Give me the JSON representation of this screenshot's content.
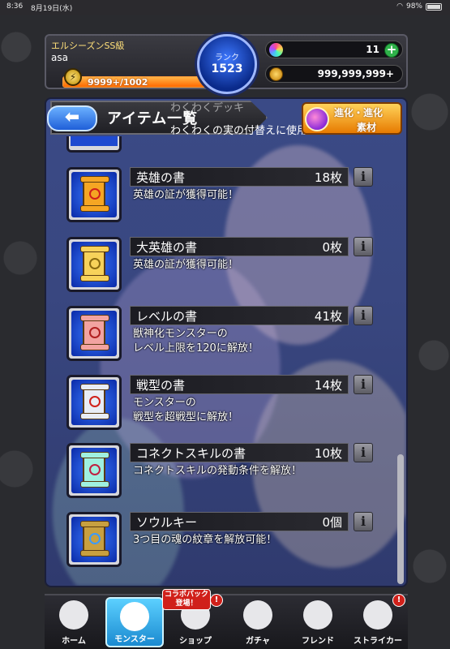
{
  "status_bar": {
    "time": "8:36",
    "date": "8月19日(水)",
    "battery": "98%"
  },
  "header": {
    "season": "エルシーズンSS級",
    "player_name": "asa",
    "stamina_text": "9999+/1002",
    "stamina_level": 1.0,
    "rank_label": "ランク",
    "rank_value": "1523",
    "gems": "11",
    "gold": "999,999,999+"
  },
  "title_bar": {
    "title": "アイテム一覧",
    "ghost_top": "わくわくデッキ",
    "ghost_bottom": "わくわくの実の付替えに使用！"
  },
  "evolve_button": {
    "line1": "進化・進化",
    "line2": "素材"
  },
  "items": [
    {
      "name": "英雄の書",
      "count": "18枚",
      "desc": [
        "英雄の証が獲得可能！"
      ],
      "scroll_color": "#f5a623",
      "mark_color": "#d0201a"
    },
    {
      "name": "大英雄の書",
      "count": "0枚",
      "desc": [
        "英雄の証が獲得可能！"
      ],
      "scroll_color": "#f7d25a",
      "mark_color": "#8a6a10"
    },
    {
      "name": "レベルの書",
      "count": "41枚",
      "desc": [
        "獣神化モンスターの",
        "レベル上限を120に解放！"
      ],
      "scroll_color": "#f2a3a0",
      "mark_color": "#b02020"
    },
    {
      "name": "戦型の書",
      "count": "14枚",
      "desc": [
        "モンスターの",
        "戦型を超戦型に解放！"
      ],
      "scroll_color": "#e8ecf5",
      "mark_color": "#d0201a"
    },
    {
      "name": "コネクトスキルの書",
      "count": "10枚",
      "desc": [
        "コネクトスキルの発動条件を解放！"
      ],
      "scroll_color": "#9ff0e0",
      "mark_color": "#c02040"
    },
    {
      "name": "ソウルキー",
      "count": "0個",
      "desc": [
        "3つ目の魂の紋章を解放可能！"
      ],
      "scroll_color": "#c8a040",
      "mark_color": "#3a9aff"
    }
  ],
  "info_label": "i",
  "nav": [
    {
      "label": "ホーム",
      "icon": "home-icon"
    },
    {
      "label": "モンスター",
      "icon": "monster-icon"
    },
    {
      "label": "ショップ",
      "icon": "cart-icon"
    },
    {
      "label": "ガチャ",
      "icon": "gacha-icon"
    },
    {
      "label": "フレンド",
      "icon": "friend-icon"
    },
    {
      "label": "ストライカー",
      "icon": "striker-icon"
    }
  ],
  "collab_badge": {
    "line1": "コラボパック",
    "line2": "登場！"
  },
  "badge_mark": "!"
}
